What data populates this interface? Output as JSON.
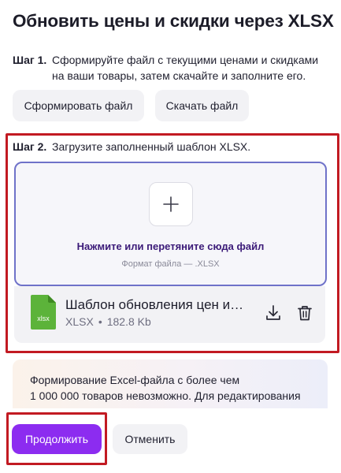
{
  "title": "Обновить цены и скидки через XLSX",
  "step1": {
    "number": "Шаг 1.",
    "line1": "Сформируйте файл с текущими ценами и скидками",
    "line2": "на ваши товары, затем скачайте и заполните его.",
    "form_button": "Сформировать файл",
    "download_button": "Скачать файл"
  },
  "step2": {
    "number": "Шаг 2.",
    "text": "Загрузите заполненный шаблон XLSX.",
    "dropzone": {
      "label": "Нажмите или перетяните сюда файл",
      "format": "Формат файла — .XLSX"
    },
    "file": {
      "icon_label": "xlsx",
      "name": "Шаблон обновления цен и…",
      "type": "XLSX",
      "separator": "•",
      "size": "182.8 Kb"
    }
  },
  "notice": {
    "line1": "Формирование Excel-файла с более чем",
    "line2": "1 000 000 товаров невозможно. Для редактирования"
  },
  "footer": {
    "continue_button": "Продолжить",
    "cancel_button": "Отменить"
  },
  "colors": {
    "accent": "#8c2cf0",
    "dropzone_border": "#6f72c9",
    "highlight": "#c21a22",
    "xlsx_icon": "#5cb33a"
  }
}
